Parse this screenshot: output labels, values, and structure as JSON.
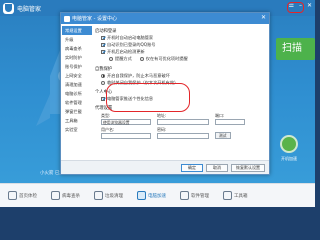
{
  "app": {
    "title": "电脑管家"
  },
  "window_controls": [
    "☰",
    "–",
    "✕"
  ],
  "hero": {
    "scan_label": "扫描",
    "user_text": "小火箭 已加速",
    "right_stat_label": "开机加速"
  },
  "dialog": {
    "title": "电脑管家 - 设置中心",
    "close": "✕",
    "nav": [
      "常规设置",
      "升级",
      "病毒查杀",
      "实时防护",
      "账号保护",
      "上网安全",
      "清理加速",
      "电脑诊所",
      "软件管理",
      "弹窗拦截",
      "工具箱",
      "实验室"
    ],
    "sections": {
      "startup_title": "启动和登录",
      "startup_items": [
        {
          "label": "开机时自动启动电脑管家",
          "checked": true
        },
        {
          "label": "自动识别已登录的QQ账号",
          "checked": true
        },
        {
          "label": "开机后启动检测更新",
          "checked": true
        }
      ],
      "launch_sub": [
        {
          "label": "提醒方式",
          "checked": false
        },
        {
          "label": "仅在有可优化项时提醒",
          "checked": false
        }
      ],
      "protect_title": "自我保护",
      "protect_options": [
        {
          "label": "开启自我保护，防止木马恶意破坏",
          "selected": true
        },
        {
          "label": "临时关闭自我保护（仅本次开机有效）",
          "selected": false
        }
      ],
      "personal_title": "个人中心",
      "personal_items": [
        {
          "label": "电脑管家推送个性化信息",
          "checked": true
        }
      ],
      "proxy_title": "代理设置",
      "proxy_type_label": "类型:",
      "proxy_type_value": "使用浏览器设置",
      "proxy_addr_label": "地址:",
      "proxy_port_label": "端口:",
      "proxy_user_label": "用户名:",
      "proxy_pass_label": "密码:",
      "proxy_test_button": "测试"
    },
    "footer": {
      "ok": "确定",
      "cancel": "取消",
      "apply": "恢复默认设置"
    }
  },
  "bottom_nav": [
    {
      "label": "首页体检",
      "active": false
    },
    {
      "label": "病毒查杀",
      "active": false
    },
    {
      "label": "垃圾清理",
      "active": false
    },
    {
      "label": "电脑加速",
      "active": true
    },
    {
      "label": "软件管理",
      "active": false
    },
    {
      "label": "工具箱",
      "active": false
    }
  ],
  "colors": {
    "primary": "#2a7bbd",
    "accent_red": "#e3262a",
    "scan_green": "#4db24b"
  }
}
